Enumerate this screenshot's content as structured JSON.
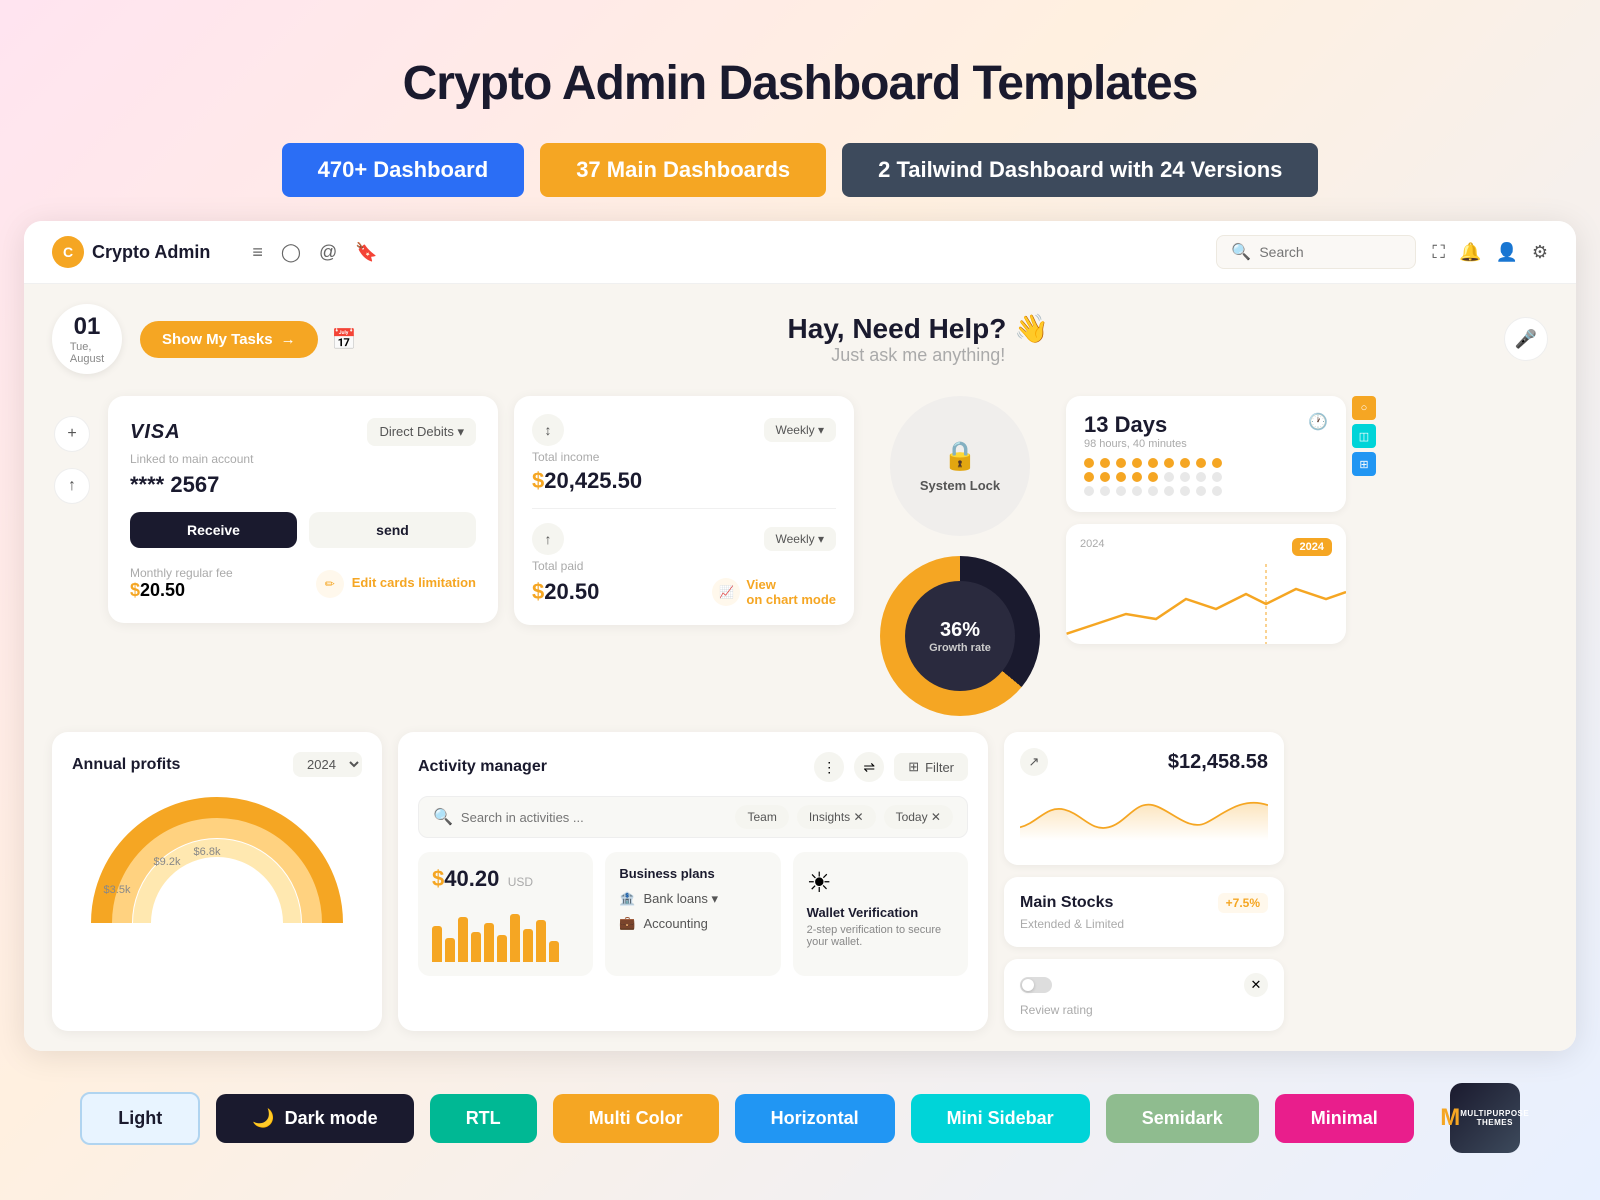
{
  "page": {
    "title": "Crypto Admin Dashboard Templates"
  },
  "badges": [
    {
      "label": "470+ Dashboard",
      "class": "badge-blue"
    },
    {
      "label": "37 Main Dashboards",
      "class": "badge-orange"
    },
    {
      "label": "2 Tailwind Dashboard with 24 Versions",
      "class": "badge-dark"
    }
  ],
  "nav": {
    "logo_text": "Crypto Admin",
    "logo_letter": "C",
    "search_placeholder": "Search",
    "icons": [
      "≡",
      "○",
      "@",
      "□"
    ]
  },
  "header": {
    "date_day": "01",
    "date_month_line1": "Tue,",
    "date_month_line2": "August",
    "show_tasks_label": "Show My Tasks",
    "greeting_title": "Hay, Need Help? 👋",
    "greeting_sub": "Just ask me anything!"
  },
  "visa_card": {
    "brand": "VISA",
    "subtitle": "Linked to main account",
    "card_number": "**** 2567",
    "direct_debits": "Direct Debits ▾",
    "btn_receive": "Receive",
    "btn_send": "send",
    "monthly_fee_label": "Monthly regular fee",
    "monthly_amount": "$20.50",
    "edit_label": "Edit\ncards limitation"
  },
  "income": {
    "total_income_label": "Total income",
    "total_income": "$20,425.50",
    "weekly": "Weekly ▾",
    "total_paid_label": "Total paid",
    "total_paid": "$20.50",
    "view_chart": "View\non chart mode"
  },
  "growth": {
    "percent": "36%",
    "label": "Growth rate"
  },
  "days_card": {
    "days": "13 Days",
    "sub": "98 hours, 40 minutes"
  },
  "chart_card": {
    "year_left": "2024",
    "year_badge": "2024"
  },
  "annual": {
    "title": "Annual profits",
    "year": "2024 ▾",
    "values": [
      {
        "label": "$3.5k",
        "color": "#f5a623",
        "r": 90
      },
      {
        "label": "$9.2k",
        "color": "#ffd280",
        "r": 70
      },
      {
        "label": "$6.8k",
        "color": "#ffe8b0",
        "r": 50
      }
    ]
  },
  "activity": {
    "title": "Activity manager",
    "search_placeholder": "Search in activities ...",
    "tags": [
      "Team",
      "Insights ✕",
      "Today ✕"
    ],
    "amount": "$40.20",
    "currency": "USD",
    "bars": [
      60,
      40,
      75,
      50,
      65,
      45,
      80,
      55,
      70,
      35
    ],
    "business_plans_title": "Business plans",
    "bp_items": [
      "Bank loans ▾",
      "Accounting"
    ],
    "wallet_title": "Wallet Verification",
    "wallet_sub": "2-step verification to secure your wallet."
  },
  "stocks": {
    "amount": "$12,458.58",
    "name": "Main Stocks",
    "sub": "Extended & Limited",
    "badge": "+7.5%",
    "review_label": "Review rating"
  },
  "system_lock": {
    "label": "System Lock"
  },
  "themes": [
    {
      "label": "Light",
      "class": "theme-light"
    },
    {
      "label": "🌙 Dark mode",
      "class": "theme-dark"
    },
    {
      "label": "RTL",
      "class": "theme-rtl"
    },
    {
      "label": "Multi Color",
      "class": "theme-multi"
    },
    {
      "label": "Horizontal",
      "class": "theme-horizontal"
    },
    {
      "label": "Mini Sidebar",
      "class": "theme-mini"
    },
    {
      "label": "Semidark",
      "class": "theme-semidark"
    },
    {
      "label": "Minimal",
      "class": "theme-minimal"
    }
  ]
}
